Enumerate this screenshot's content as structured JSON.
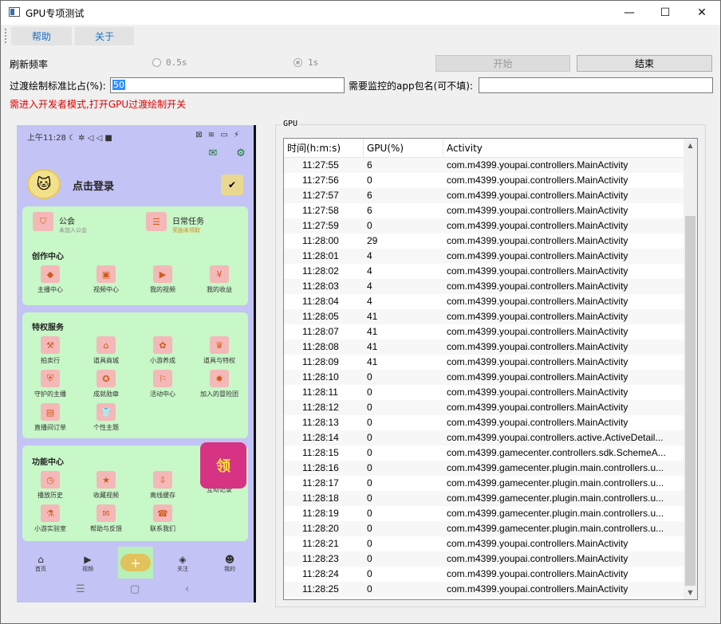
{
  "window": {
    "title": "GPU专项测试",
    "min": "—",
    "max": "☐",
    "close": "✕"
  },
  "menu": {
    "help": "帮助",
    "about": "关于"
  },
  "refresh": {
    "label": "刷新频率",
    "opt1": "0.5s",
    "opt2": "1s"
  },
  "buttons": {
    "start": "开始",
    "end": "结束"
  },
  "overdraw": {
    "label": "过渡绘制标准比占(%):",
    "value": "50"
  },
  "package": {
    "label": "需要监控的app包名(可不填):",
    "value": ""
  },
  "warning": "需进入开发者模式,打开GPU过渡绘制开关",
  "phone": {
    "status_time": "上午11:28 ☾ ✲ ◁ ◁ ■",
    "status_icons": "⊠ ≋ ▭ ⚡",
    "login": "点击登录",
    "guild": {
      "title": "公会",
      "sub": "未加入公会"
    },
    "daily": {
      "title": "日常任务",
      "sub": "奖励未领取"
    },
    "create_center": "创作中心",
    "create_items": [
      "主播中心",
      "视频中心",
      "我的视频",
      "我的收益"
    ],
    "privilege": "特权服务",
    "privilege_items": [
      "拍卖行",
      "道具商城",
      "小游养成",
      "道具与特权",
      "守护的主播",
      "成就勋章",
      "活动中心",
      "加入的冒险团",
      "直播间订单",
      "个性主题"
    ],
    "function_center": "功能中心",
    "function_items": [
      "播放历史",
      "收藏视频",
      "离线缓存",
      "互动记录",
      "小游实验室",
      "帮助与反馈",
      "联系我们"
    ],
    "promo": "领",
    "nav": [
      "首页",
      "视频",
      "关注",
      "我的"
    ],
    "plus": "+",
    "sysnav": [
      "☰",
      "▢",
      "‹"
    ]
  },
  "gpu": {
    "group_label": "GPU",
    "headers": [
      "时间(h:m:s)",
      "GPU(%)",
      "Activity"
    ],
    "rows": [
      [
        "11:27:55",
        "6",
        "com.m4399.youpai.controllers.MainActivity"
      ],
      [
        "11:27:56",
        "0",
        "com.m4399.youpai.controllers.MainActivity"
      ],
      [
        "11:27:57",
        "6",
        "com.m4399.youpai.controllers.MainActivity"
      ],
      [
        "11:27:58",
        "6",
        "com.m4399.youpai.controllers.MainActivity"
      ],
      [
        "11:27:59",
        "0",
        "com.m4399.youpai.controllers.MainActivity"
      ],
      [
        "11:28:00",
        "29",
        "com.m4399.youpai.controllers.MainActivity"
      ],
      [
        "11:28:01",
        "4",
        "com.m4399.youpai.controllers.MainActivity"
      ],
      [
        "11:28:02",
        "4",
        "com.m4399.youpai.controllers.MainActivity"
      ],
      [
        "11:28:03",
        "4",
        "com.m4399.youpai.controllers.MainActivity"
      ],
      [
        "11:28:04",
        "4",
        "com.m4399.youpai.controllers.MainActivity"
      ],
      [
        "11:28:05",
        "41",
        "com.m4399.youpai.controllers.MainActivity"
      ],
      [
        "11:28:07",
        "41",
        "com.m4399.youpai.controllers.MainActivity"
      ],
      [
        "11:28:08",
        "41",
        "com.m4399.youpai.controllers.MainActivity"
      ],
      [
        "11:28:09",
        "41",
        "com.m4399.youpai.controllers.MainActivity"
      ],
      [
        "11:28:10",
        "0",
        "com.m4399.youpai.controllers.MainActivity"
      ],
      [
        "11:28:11",
        "0",
        "com.m4399.youpai.controllers.MainActivity"
      ],
      [
        "11:28:12",
        "0",
        "com.m4399.youpai.controllers.MainActivity"
      ],
      [
        "11:28:13",
        "0",
        "com.m4399.youpai.controllers.MainActivity"
      ],
      [
        "11:28:14",
        "0",
        "com.m4399.youpai.controllers.active.ActiveDetail..."
      ],
      [
        "11:28:15",
        "0",
        "com.m4399.gamecenter.controllers.sdk.SchemeA..."
      ],
      [
        "11:28:16",
        "0",
        "com.m4399.gamecenter.plugin.main.controllers.u..."
      ],
      [
        "11:28:17",
        "0",
        "com.m4399.gamecenter.plugin.main.controllers.u..."
      ],
      [
        "11:28:18",
        "0",
        "com.m4399.gamecenter.plugin.main.controllers.u..."
      ],
      [
        "11:28:19",
        "0",
        "com.m4399.gamecenter.plugin.main.controllers.u..."
      ],
      [
        "11:28:20",
        "0",
        "com.m4399.gamecenter.plugin.main.controllers.u..."
      ],
      [
        "11:28:21",
        "0",
        "com.m4399.youpai.controllers.MainActivity"
      ],
      [
        "11:28:23",
        "0",
        "com.m4399.youpai.controllers.MainActivity"
      ],
      [
        "11:28:24",
        "0",
        "com.m4399.youpai.controllers.MainActivity"
      ],
      [
        "11:28:25",
        "0",
        "com.m4399.youpai.controllers.MainActivity"
      ]
    ]
  }
}
